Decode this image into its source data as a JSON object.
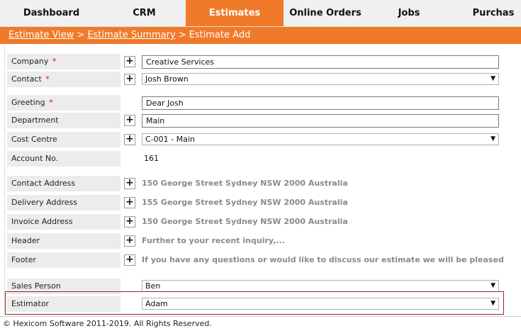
{
  "tabs": [
    {
      "label": "Dashboard"
    },
    {
      "label": "CRM"
    },
    {
      "label": "Estimates"
    },
    {
      "label": "Online Orders"
    },
    {
      "label": "Jobs"
    },
    {
      "label": "Purchas"
    }
  ],
  "active_tab_color": "#f07a2a",
  "breadcrumb": {
    "link1": "Estimate View",
    "link2": "Estimate Summary",
    "current": "Estimate Add",
    "separator": ">"
  },
  "form": {
    "company": {
      "label": "Company",
      "required": "*",
      "value": "Creative Services"
    },
    "contact": {
      "label": "Contact",
      "required": "*",
      "value": "Josh Brown"
    },
    "greeting": {
      "label": "Greeting",
      "required": "*",
      "value": "Dear Josh"
    },
    "department": {
      "label": "Department",
      "value": "Main"
    },
    "cost_centre": {
      "label": "Cost Centre",
      "value": "C-001 - Main"
    },
    "account_no": {
      "label": "Account No.",
      "value": "161"
    },
    "contact_address": {
      "label": "Contact Address",
      "value": "150 George Street Sydney NSW 2000 Australia"
    },
    "delivery_address": {
      "label": "Delivery Address",
      "value": "155 George Street Sydney NSW 2000 Australia"
    },
    "invoice_address": {
      "label": "Invoice Address",
      "value": "150 George Street Sydney NSW 2000 Australia"
    },
    "header": {
      "label": "Header",
      "value": "Further to your recent inquiry,..."
    },
    "footer_text": {
      "label": "Footer",
      "value": "If you have any questions or would like to discuss our estimate we will be pleased"
    },
    "sales_person": {
      "label": "Sales Person",
      "value": "Ben"
    },
    "estimator": {
      "label": "Estimator",
      "value": "Adam"
    }
  },
  "plus_glyph": "+",
  "caret_glyph": "▼",
  "footer": {
    "copyright": "© Hexicom Software 2011-2019. All Rights Reserved."
  }
}
